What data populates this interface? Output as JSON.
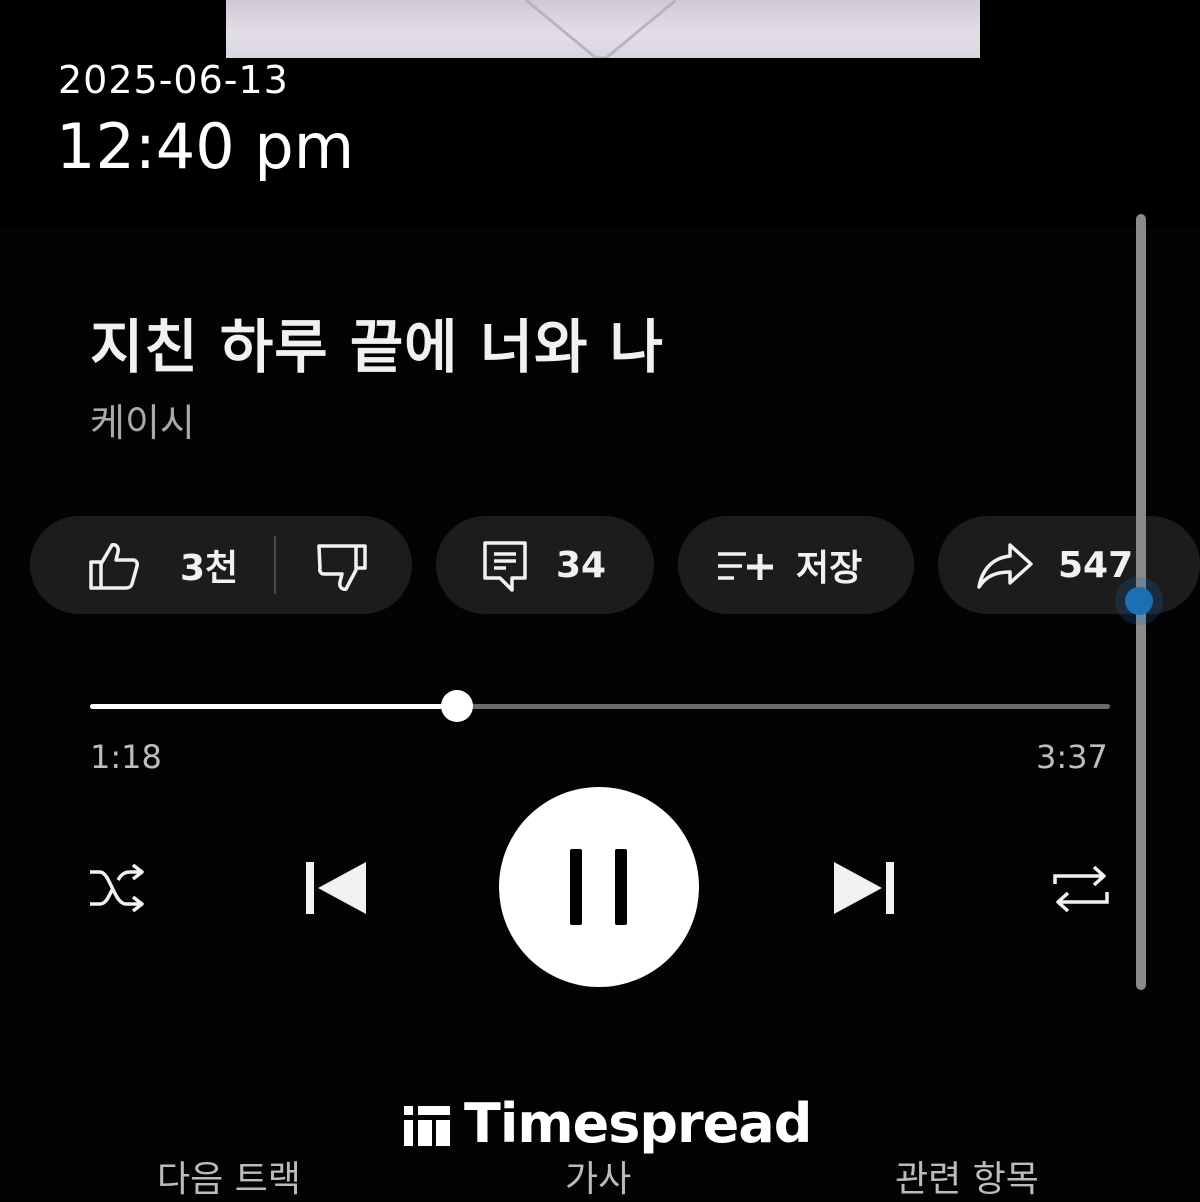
{
  "status": {
    "date": "2025-06-13",
    "time": "12:40 pm"
  },
  "track": {
    "title": "지친 하루 끝에 너와 나",
    "artist": "케이시"
  },
  "actions": {
    "like_count": "3천",
    "comment_count": "34",
    "save_label": "저장",
    "share_count": "547"
  },
  "playback": {
    "current_time": "1:18",
    "total_time": "3:37",
    "progress_fraction": 0.36,
    "state": "playing"
  },
  "watermark": {
    "brand": "Timespread"
  },
  "tabs": [
    {
      "label": "다음 트랙"
    },
    {
      "label": "가사"
    },
    {
      "label": "관련 항목"
    }
  ],
  "colors": {
    "background": "#000000",
    "pill_background": "#1c1c1c",
    "scroll_indicator": "#1b6fb3",
    "progress_played": "#ffffff",
    "progress_remaining": "#6b6b6b"
  },
  "icons": {
    "like": "thumbs-up-icon",
    "dislike": "thumbs-down-icon",
    "comment": "comment-icon",
    "save": "playlist-add-icon",
    "share": "share-arrow-icon",
    "shuffle": "shuffle-icon",
    "previous": "skip-previous-icon",
    "pause": "pause-icon",
    "next": "skip-next-icon",
    "repeat": "repeat-icon"
  }
}
